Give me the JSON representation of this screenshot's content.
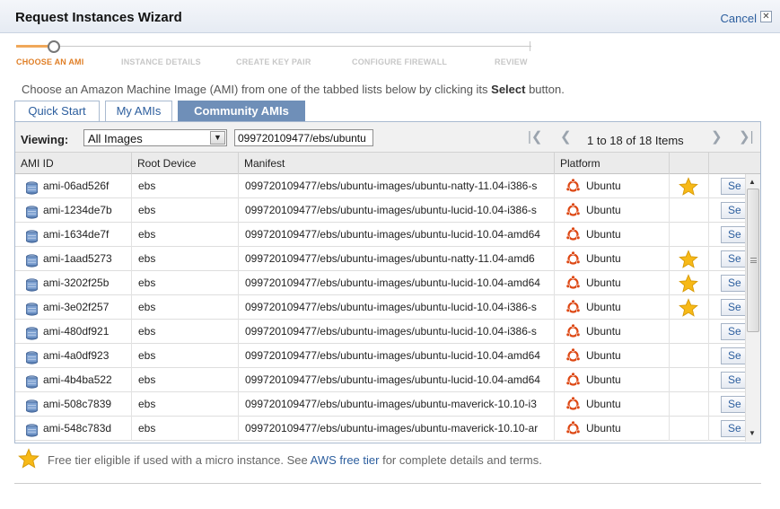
{
  "window": {
    "title": "Request Instances Wizard",
    "cancel_label": "Cancel",
    "close_glyph": "✕"
  },
  "steps": [
    {
      "label": "CHOOSE AN AMI",
      "active": true
    },
    {
      "label": "INSTANCE DETAILS",
      "active": false
    },
    {
      "label": "CREATE KEY PAIR",
      "active": false
    },
    {
      "label": "CONFIGURE FIREWALL",
      "active": false
    },
    {
      "label": "REVIEW",
      "active": false
    }
  ],
  "intro": {
    "text_before": "Choose an Amazon Machine Image (AMI) from one of the tabbed lists below by clicking its ",
    "bold": "Select",
    "text_after": " button."
  },
  "tabs": [
    {
      "label": "Quick Start",
      "active": false
    },
    {
      "label": "My AMIs",
      "active": false
    },
    {
      "label": "Community AMIs",
      "active": true
    }
  ],
  "toolbar": {
    "viewing_label": "Viewing:",
    "viewing_value": "All Images",
    "search_value": "099720109477/ebs/ubuntu",
    "pager_text": "1 to 18 of 18 Items"
  },
  "columns": [
    "AMI ID",
    "Root Device",
    "Manifest",
    "Platform",
    "",
    ""
  ],
  "rows": [
    {
      "ami": "ami-06ad526f",
      "root": "ebs",
      "manifest": "099720109477/ebs/ubuntu-images/ubuntu-natty-11.04-i386-s",
      "platform": "Ubuntu",
      "star": true,
      "select": "Se"
    },
    {
      "ami": "ami-1234de7b",
      "root": "ebs",
      "manifest": "099720109477/ebs/ubuntu-images/ubuntu-lucid-10.04-i386-s",
      "platform": "Ubuntu",
      "star": false,
      "select": "Se"
    },
    {
      "ami": "ami-1634de7f",
      "root": "ebs",
      "manifest": "099720109477/ebs/ubuntu-images/ubuntu-lucid-10.04-amd64",
      "platform": "Ubuntu",
      "star": false,
      "select": "Se"
    },
    {
      "ami": "ami-1aad5273",
      "root": "ebs",
      "manifest": "099720109477/ebs/ubuntu-images/ubuntu-natty-11.04-amd6",
      "platform": "Ubuntu",
      "star": true,
      "select": "Se"
    },
    {
      "ami": "ami-3202f25b",
      "root": "ebs",
      "manifest": "099720109477/ebs/ubuntu-images/ubuntu-lucid-10.04-amd64",
      "platform": "Ubuntu",
      "star": true,
      "select": "Se"
    },
    {
      "ami": "ami-3e02f257",
      "root": "ebs",
      "manifest": "099720109477/ebs/ubuntu-images/ubuntu-lucid-10.04-i386-s",
      "platform": "Ubuntu",
      "star": true,
      "select": "Se"
    },
    {
      "ami": "ami-480df921",
      "root": "ebs",
      "manifest": "099720109477/ebs/ubuntu-images/ubuntu-lucid-10.04-i386-s",
      "platform": "Ubuntu",
      "star": false,
      "select": "Se"
    },
    {
      "ami": "ami-4a0df923",
      "root": "ebs",
      "manifest": "099720109477/ebs/ubuntu-images/ubuntu-lucid-10.04-amd64",
      "platform": "Ubuntu",
      "star": false,
      "select": "Se"
    },
    {
      "ami": "ami-4b4ba522",
      "root": "ebs",
      "manifest": "099720109477/ebs/ubuntu-images/ubuntu-lucid-10.04-amd64",
      "platform": "Ubuntu",
      "star": false,
      "select": "Se"
    },
    {
      "ami": "ami-508c7839",
      "root": "ebs",
      "manifest": "099720109477/ebs/ubuntu-images/ubuntu-maverick-10.10-i3",
      "platform": "Ubuntu",
      "star": false,
      "select": "Se"
    },
    {
      "ami": "ami-548c783d",
      "root": "ebs",
      "manifest": "099720109477/ebs/ubuntu-images/ubuntu-maverick-10.10-ar",
      "platform": "Ubuntu",
      "star": false,
      "select": "Se"
    }
  ],
  "footer": {
    "text_before": "Free tier eligible if used with a micro instance. See ",
    "link": "AWS free tier",
    "text_after": " for complete details and terms."
  },
  "colors": {
    "accent": "#e07f27",
    "link": "#2c5e9e",
    "tab_active": "#6f8fb8",
    "star": "#f4b400",
    "ubuntu": "#dd4814"
  },
  "icons": {
    "ami": "ami-cylinder-icon",
    "platform": "ubuntu-logo-icon",
    "free_tier": "star-icon"
  }
}
